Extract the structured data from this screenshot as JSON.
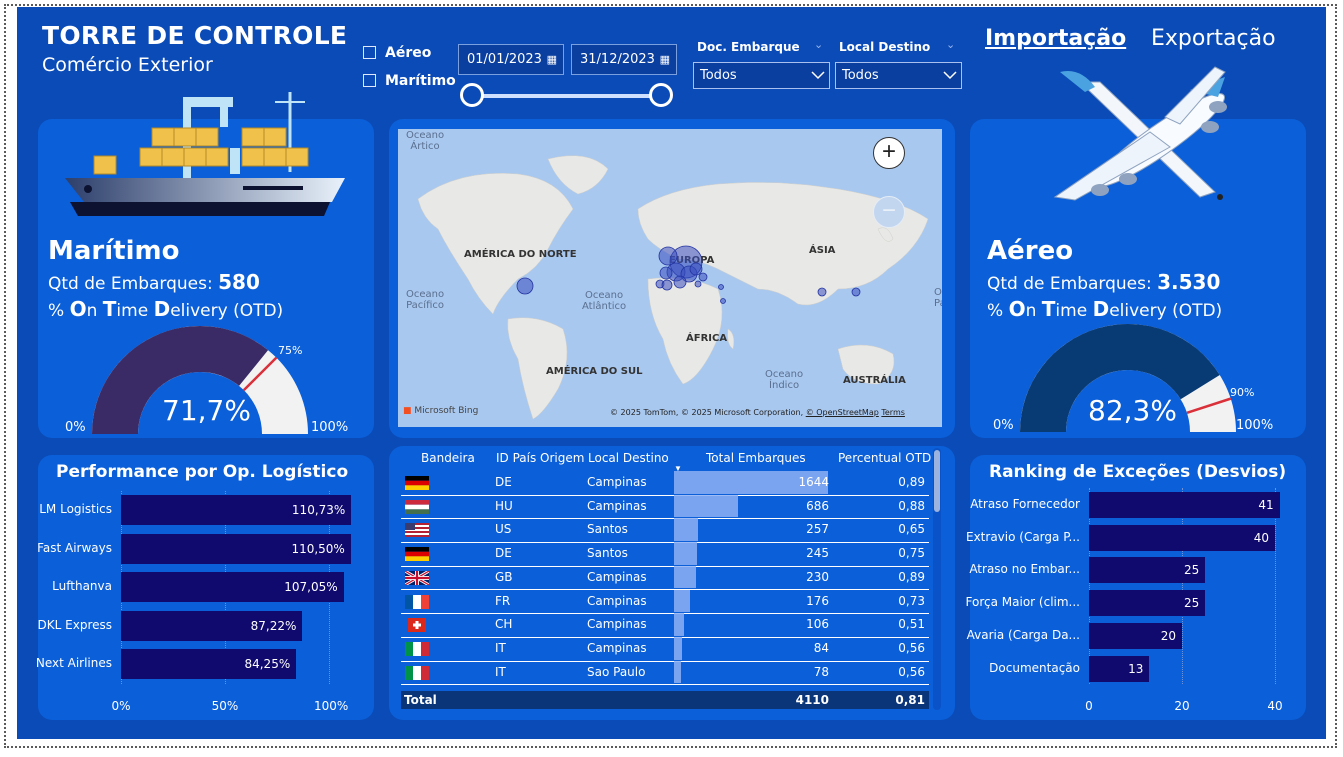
{
  "header": {
    "title": "TORRE DE CONTROLE",
    "subtitle": "Comércio Exterior"
  },
  "filters": {
    "aereo_label": "Aéreo",
    "maritimo_label": "Marítimo",
    "date_start": "01/01/2023",
    "date_end": "31/12/2023",
    "slider_start_fraction": 0,
    "slider_end_fraction": 1,
    "doc_embarque_label": "Doc. Embarque",
    "doc_embarque_value": "Todos",
    "local_destino_label": "Local Destino",
    "local_destino_value": "Todos"
  },
  "nav": {
    "importacao": "Importação",
    "exportacao": "Exportação"
  },
  "maritimo": {
    "name": "Marítimo",
    "qtd_label": "Qtd de Embarques:",
    "qtd_value": "580",
    "otd_prefix": "% ",
    "otd_o": "O",
    "otd_n": "n ",
    "otd_t": "T",
    "otd_ime": "ime ",
    "otd_d": "D",
    "otd_rest": "elivery (OTD)",
    "gauge_value_text": "71,7%",
    "gauge_value": 71.7,
    "target_value": 75,
    "target_text": "75%",
    "min_text": "0%",
    "max_text": "100%",
    "fill_color": "#3a2a66",
    "track_color": "#f2f2f2",
    "target_color": "#d9303a"
  },
  "aereo": {
    "name": "Aéreo",
    "qtd_label": "Qtd de Embarques:",
    "qtd_value": "3.530",
    "otd_prefix": "% ",
    "otd_o": "O",
    "otd_n": "n ",
    "otd_t": "T",
    "otd_ime": "ime ",
    "otd_d": "D",
    "otd_rest": "elivery (OTD)",
    "gauge_value_text": "82,3%",
    "gauge_value": 82.3,
    "target_value": 90,
    "target_text": "90%",
    "min_text": "0%",
    "max_text": "100%",
    "fill_color": "#083a74",
    "track_color": "#f2f2f2",
    "target_color": "#d9303a"
  },
  "map": {
    "labels": {
      "oceano_artico": [
        "Oceano",
        "Ártico"
      ],
      "america_norte": "AMÉRICA DO NORTE",
      "europa": "EUROPA",
      "asia": "ÁSIA",
      "oceano_pacifico": [
        "Oceano",
        "Pacífico"
      ],
      "oceano_atlantico": [
        "Oceano",
        "Atlântico"
      ],
      "africa": "ÁFRICA",
      "america_sul": "AMÉRICA DO SUL",
      "oceano_indico": [
        "Oceano",
        "Índico"
      ],
      "australia": "AUSTRÁLIA",
      "oceano_right": [
        "Oceano",
        "Pacífico"
      ]
    },
    "bing": "Microsoft Bing",
    "copyright": "© 2025 TomTom, © 2025 Microsoft Corporation,",
    "osm": "© OpenStreetMap",
    "terms": "Terms",
    "zoom_in": "+",
    "zoom_out": "−"
  },
  "table": {
    "headers": [
      "Bandeira",
      "ID País Origem",
      "Local Destino",
      "Total Embarques",
      "Percentual OTD"
    ],
    "rows": [
      {
        "flag": "de",
        "country": "DE",
        "dest": "Campinas",
        "total": 1644,
        "total_text": "1644",
        "otd": "0,89"
      },
      {
        "flag": "hu",
        "country": "HU",
        "dest": "Campinas",
        "total": 686,
        "total_text": "686",
        "otd": "0,88"
      },
      {
        "flag": "us",
        "country": "US",
        "dest": "Santos",
        "total": 257,
        "total_text": "257",
        "otd": "0,65"
      },
      {
        "flag": "de",
        "country": "DE",
        "dest": "Santos",
        "total": 245,
        "total_text": "245",
        "otd": "0,75"
      },
      {
        "flag": "gb",
        "country": "GB",
        "dest": "Campinas",
        "total": 230,
        "total_text": "230",
        "otd": "0,89"
      },
      {
        "flag": "fr",
        "country": "FR",
        "dest": "Campinas",
        "total": 176,
        "total_text": "176",
        "otd": "0,73"
      },
      {
        "flag": "ch",
        "country": "CH",
        "dest": "Campinas",
        "total": 106,
        "total_text": "106",
        "otd": "0,51"
      },
      {
        "flag": "it",
        "country": "IT",
        "dest": "Campinas",
        "total": 84,
        "total_text": "84",
        "otd": "0,56"
      },
      {
        "flag": "it",
        "country": "IT",
        "dest": "Sao Paulo",
        "total": 78,
        "total_text": "78",
        "otd": "0,56"
      }
    ],
    "total_label": "Total",
    "total_value": "4110",
    "total_otd": "0,81",
    "bar_color": "#8fb0f5"
  },
  "performance": {
    "title": "Performance por Op. Logístico",
    "axis": [
      "0%",
      "50%",
      "100%"
    ],
    "chart_data": {
      "type": "bar",
      "categories": [
        "LM Logistics",
        "Fast Airways",
        "Lufthanva",
        "DKL Express",
        "Next Airlines"
      ],
      "values": [
        110.73,
        110.5,
        107.05,
        87.22,
        84.25
      ],
      "value_labels": [
        "110,73%",
        "110,50%",
        "107,05%",
        "87,22%",
        "84,25%"
      ],
      "xlim": [
        0,
        110.73
      ]
    }
  },
  "ranking": {
    "title": "Ranking de Exceções (Desvios)",
    "axis": [
      "0",
      "20",
      "40"
    ],
    "chart_data": {
      "type": "bar",
      "categories": [
        "Atraso Fornecedor",
        "Extravio (Carga P...",
        "Atraso no Embar...",
        "Força Maior (clim...",
        "Avaria (Carga Da...",
        "Documentação"
      ],
      "values": [
        41,
        40,
        25,
        25,
        20,
        13
      ],
      "xlim": [
        0,
        41
      ]
    }
  },
  "colors": {
    "background": "#0a4bb8",
    "panel": "#0b5fd8",
    "bar": "#100a6e"
  }
}
